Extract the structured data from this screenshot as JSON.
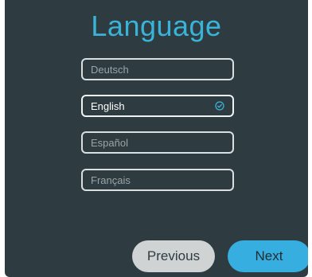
{
  "screen": {
    "title": "Language"
  },
  "languages": [
    {
      "label": "Deutsch",
      "selected": false
    },
    {
      "label": "English",
      "selected": true
    },
    {
      "label": "Español",
      "selected": false
    },
    {
      "label": "Français",
      "selected": false
    }
  ],
  "buttons": {
    "previous_label": "Previous",
    "next_label": "Next"
  },
  "colors": {
    "background": "#2e3c42",
    "accent": "#39b3d7",
    "next_button": "#37aee0",
    "previous_button": "#cfd3d4"
  }
}
